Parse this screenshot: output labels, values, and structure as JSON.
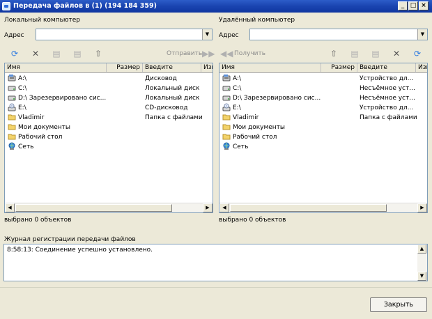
{
  "window": {
    "title": "Передача файлов в  (1) (194 184 359)"
  },
  "controls": {
    "minimize": "_",
    "maximize": "□",
    "close": "×"
  },
  "local": {
    "label": "Локальный компьютер",
    "address_label": "Адрес",
    "address_value": "",
    "toolbar": {
      "send_label": "Отправить"
    },
    "columns": [
      "Имя",
      "Размер",
      "Введите",
      "Изм"
    ],
    "rows": [
      {
        "name": "A:\\",
        "type": "Дисковод",
        "icon": "floppy-drive-icon"
      },
      {
        "name": "C:\\",
        "type": "Локальный диск",
        "icon": "hard-drive-icon"
      },
      {
        "name": "D:\\ Зарезервировано сис...",
        "type": "Локальный диск",
        "icon": "hard-drive-icon"
      },
      {
        "name": "E:\\",
        "type": "CD-дисковод",
        "icon": "cd-drive-icon"
      },
      {
        "name": "Vladimir",
        "type": "Папка с файлами",
        "icon": "folder-icon"
      },
      {
        "name": "Мои документы",
        "type": "",
        "icon": "folder-icon"
      },
      {
        "name": "Рабочий стол",
        "type": "",
        "icon": "folder-icon"
      },
      {
        "name": "Сеть",
        "type": "",
        "icon": "network-icon"
      }
    ],
    "status": "выбрано 0 объектов"
  },
  "remote": {
    "label": "Удалённый компьютер",
    "address_label": "Адрес",
    "address_value": "",
    "toolbar": {
      "receive_label": "Получить"
    },
    "columns": [
      "Имя",
      "Размер",
      "Введите",
      "Изм"
    ],
    "rows": [
      {
        "name": "A:\\",
        "type": "Устройство дл...",
        "icon": "floppy-drive-icon"
      },
      {
        "name": "C:\\",
        "type": "Несъёмное уст...",
        "icon": "hard-drive-icon"
      },
      {
        "name": "D:\\ Зарезервировано сис...",
        "type": "Несъёмное уст...",
        "icon": "hard-drive-icon"
      },
      {
        "name": "E:\\",
        "type": "Устройство дл...",
        "icon": "cd-drive-icon"
      },
      {
        "name": "Vladimir",
        "type": "Папка с файлами",
        "icon": "folder-icon"
      },
      {
        "name": "Мои документы",
        "type": "",
        "icon": "folder-icon"
      },
      {
        "name": "Рабочий стол",
        "type": "",
        "icon": "folder-icon"
      },
      {
        "name": "Сеть",
        "type": "",
        "icon": "network-icon"
      }
    ],
    "status": "выбрано 0 объектов"
  },
  "log": {
    "label": "Журнал регистрации передачи файлов",
    "lines": [
      "8:58:13: Соединение успешно установлено."
    ]
  },
  "footer": {
    "close_label": "Закрыть"
  },
  "colors": {
    "titlebar": "#1a44b0",
    "window_bg": "#ece9d8",
    "list_border": "#7f9db9",
    "accent_blue": "#2f7be0"
  }
}
